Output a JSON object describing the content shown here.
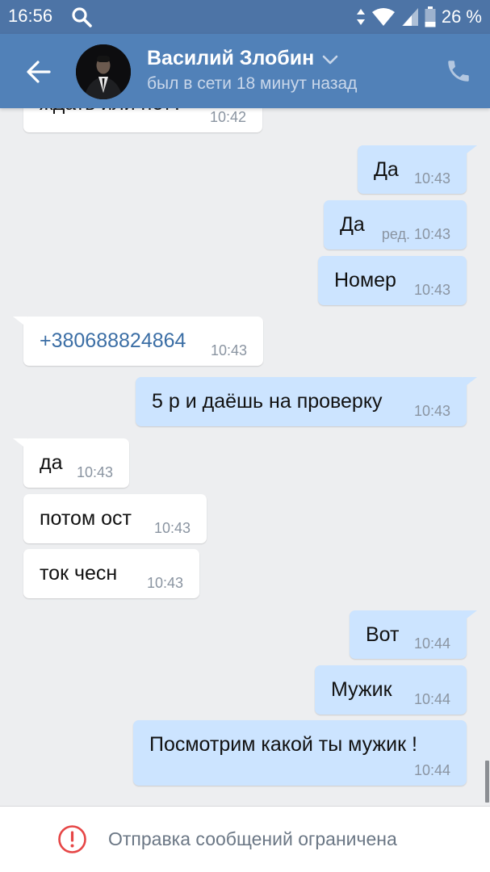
{
  "status_bar": {
    "time": "16:56",
    "battery": "26 %",
    "icons": [
      "search-icon",
      "data-arrows-icon",
      "wifi-icon",
      "signal-icon",
      "battery-icon"
    ]
  },
  "header": {
    "contact_name": "Василий Злобин",
    "status": "был в сети 18 минут назад",
    "icons": [
      "back-arrow-icon",
      "chevron-down-icon",
      "phone-icon"
    ]
  },
  "messages": [
    {
      "dir": "in",
      "text": "ждать или нет?",
      "time": "10:42"
    },
    {
      "dir": "out",
      "text": "Да",
      "time": "10:43"
    },
    {
      "dir": "out",
      "text": "Да",
      "edited": "ред.",
      "time": "10:43"
    },
    {
      "dir": "out",
      "text": "Номер",
      "time": "10:43"
    },
    {
      "dir": "in",
      "text": "+380688824864",
      "time": "10:43",
      "link": true
    },
    {
      "dir": "out",
      "text": "5 р и даёшь на проверку",
      "time": "10:43"
    },
    {
      "dir": "in",
      "text": "да",
      "time": "10:43"
    },
    {
      "dir": "in",
      "text": "потом ост",
      "time": "10:43"
    },
    {
      "dir": "in",
      "text": "ток чесн",
      "time": "10:43"
    },
    {
      "dir": "out",
      "text": "Вот",
      "time": "10:44"
    },
    {
      "dir": "out",
      "text": "Мужик",
      "time": "10:44"
    },
    {
      "dir": "out",
      "text": "Посмотрим какой ты мужик !",
      "time": "10:44"
    }
  ],
  "footer": {
    "notice": "Отправка сообщений ограничена",
    "icon": "alert-circle-icon"
  },
  "colors": {
    "header_bg": "#5181b8",
    "statusbar_bg": "#4d74a6",
    "chat_bg": "#edeef0",
    "outgoing_bubble": "#cce4ff",
    "incoming_bubble": "#ffffff",
    "link": "#3b6ea5",
    "alert": "#e64646"
  }
}
